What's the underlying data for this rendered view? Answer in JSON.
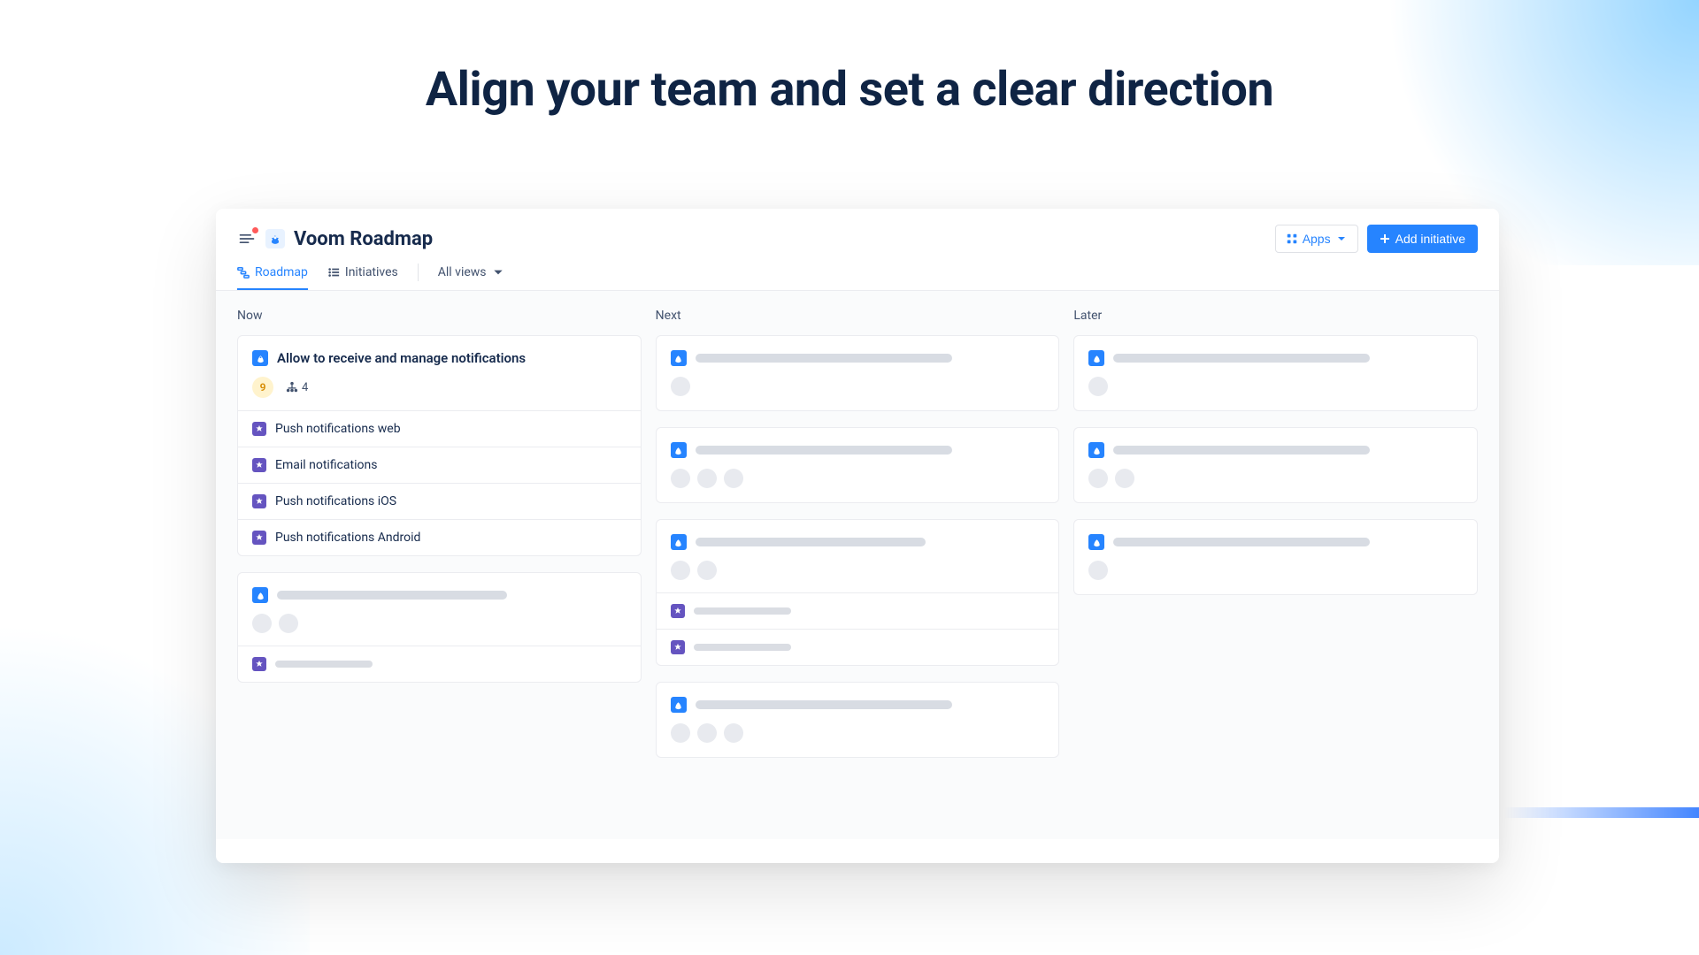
{
  "hero": "Align your team and set a clear direction",
  "header": {
    "title": "Voom Roadmap",
    "apps_label": "Apps",
    "add_label": "Add initiative"
  },
  "tabs": {
    "roadmap": "Roadmap",
    "initiatives": "Initiatives",
    "all_views": "All views"
  },
  "columns": {
    "now": "Now",
    "next": "Next",
    "later": "Later"
  },
  "now_card": {
    "title": "Allow to receive and manage notifications",
    "count": "9",
    "children_count": "4",
    "items": [
      "Push notifications web",
      "Email notifications",
      "Push notifications iOS",
      "Push notifications Android"
    ]
  }
}
